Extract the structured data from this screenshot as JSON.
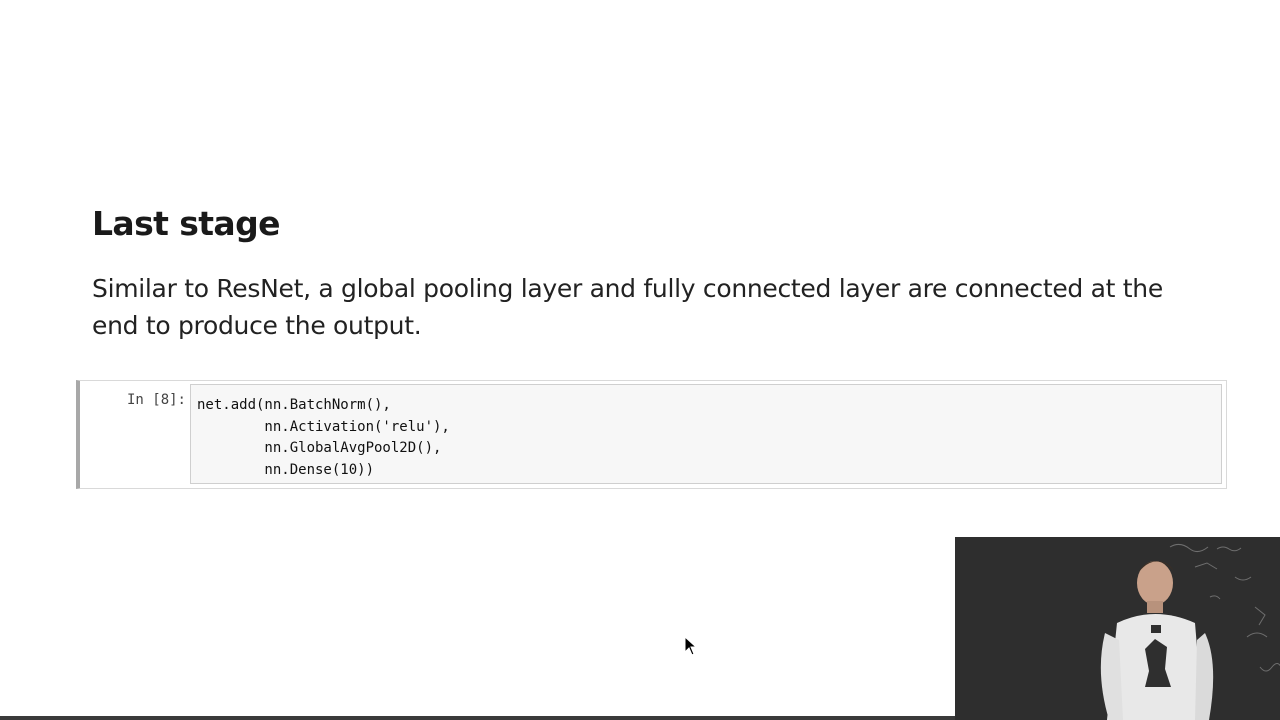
{
  "slide": {
    "heading": "Last stage",
    "paragraph": "Similar to ResNet, a global pooling layer and fully connected layer are connected at the end to produce the output."
  },
  "code_cell": {
    "prompt": "In [8]:",
    "lines": [
      "net.add(nn.BatchNorm(),",
      "        nn.Activation('relu'),",
      "        nn.GlobalAvgPool2D(),",
      "        nn.Dense(10))"
    ]
  },
  "colors": {
    "cell_border_active": "#a8a8a8",
    "code_background": "#f7f7f7",
    "video_background": "#2f2f2f"
  },
  "icons": {
    "cursor": "mouse-pointer-icon"
  }
}
